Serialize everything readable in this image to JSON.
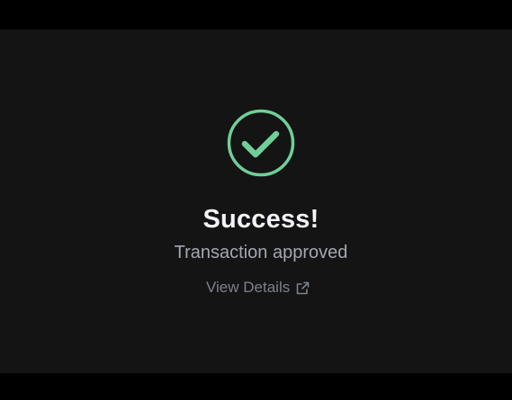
{
  "status": {
    "icon": "check-circle-icon",
    "title": "Success!",
    "message": "Transaction approved"
  },
  "actions": {
    "view_details_label": "View Details",
    "view_details_icon": "external-link-icon"
  },
  "colors": {
    "background": "#141414",
    "frame": "#000000",
    "success": "#6fcf97",
    "title": "#f3f4f8",
    "subtitle": "#a3a7b0",
    "link": "#7d818a"
  }
}
